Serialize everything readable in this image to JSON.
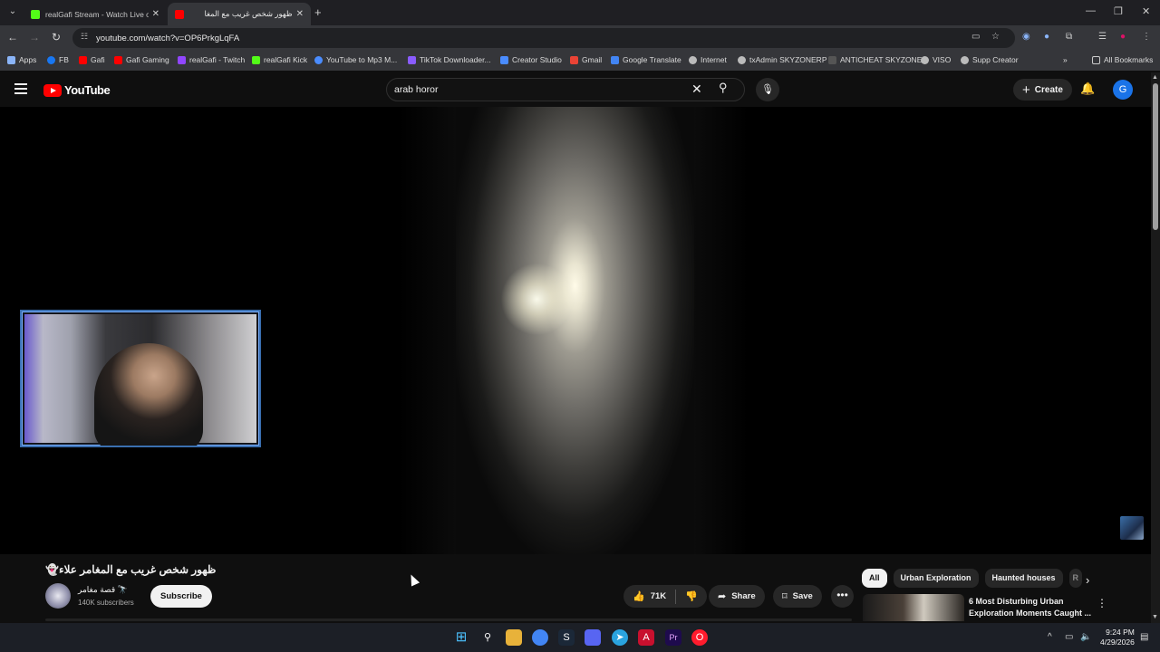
{
  "browser": {
    "tabs": [
      {
        "title": "realGafi Stream - Watch Live on",
        "active": false,
        "favicon_color": "#53fc18"
      },
      {
        "title": "ظهور شخص غريب مع المغا",
        "active": true,
        "favicon_color": "#ff0000"
      }
    ],
    "url": "youtube.com/watch?v=OP6PrkgLqFA",
    "bookmarks": [
      {
        "label": "Apps",
        "color": "#8ab4f8"
      },
      {
        "label": "FB",
        "color": "#1877f2"
      },
      {
        "label": "Gafi",
        "color": "#ff0000"
      },
      {
        "label": "Gafi Gaming",
        "color": "#ff0000"
      },
      {
        "label": "realGafi - Twitch",
        "color": "#9146ff"
      },
      {
        "label": "realGafi Kick",
        "color": "#53fc18"
      },
      {
        "label": "YouTube to Mp3 M...",
        "color": "#4a8cff"
      },
      {
        "label": "TikTok Downloader...",
        "color": "#8a5cff"
      },
      {
        "label": "Creator Studio",
        "color": "#4a8cff"
      },
      {
        "label": "Gmail",
        "color": "#ea4335"
      },
      {
        "label": "Google Translate",
        "color": "#4285f4"
      },
      {
        "label": "Internet",
        "color": "#bbbbbb"
      },
      {
        "label": "txAdmin SKYZONERP",
        "color": "#bbbbbb"
      },
      {
        "label": "ANTICHEAT SKYZONE",
        "color": "#555555"
      },
      {
        "label": "VISO",
        "color": "#bbbbbb"
      },
      {
        "label": "Supp Creator",
        "color": "#bbbbbb"
      }
    ],
    "all_bookmarks": "All Bookmarks"
  },
  "youtube": {
    "logo_text": "YouTube",
    "search_value": "arab horor",
    "create_label": "Create",
    "avatar_letter": "G"
  },
  "video": {
    "title": "ظهور شخص غريب مع المغامر علاء👻",
    "channel_name": "قصة مغامر 🔭",
    "subscribers": "140K subscribers",
    "subscribe_label": "Subscribe",
    "likes": "71K",
    "share_label": "Share",
    "save_label": "Save"
  },
  "chips": [
    "All",
    "Urban Exploration",
    "Haunted houses",
    "R"
  ],
  "recommendation": {
    "title": "6 Most Disturbing Urban Exploration Moments Caught ..."
  },
  "taskbar": {
    "time": "9:24 PM",
    "date": "4/29/2026"
  }
}
